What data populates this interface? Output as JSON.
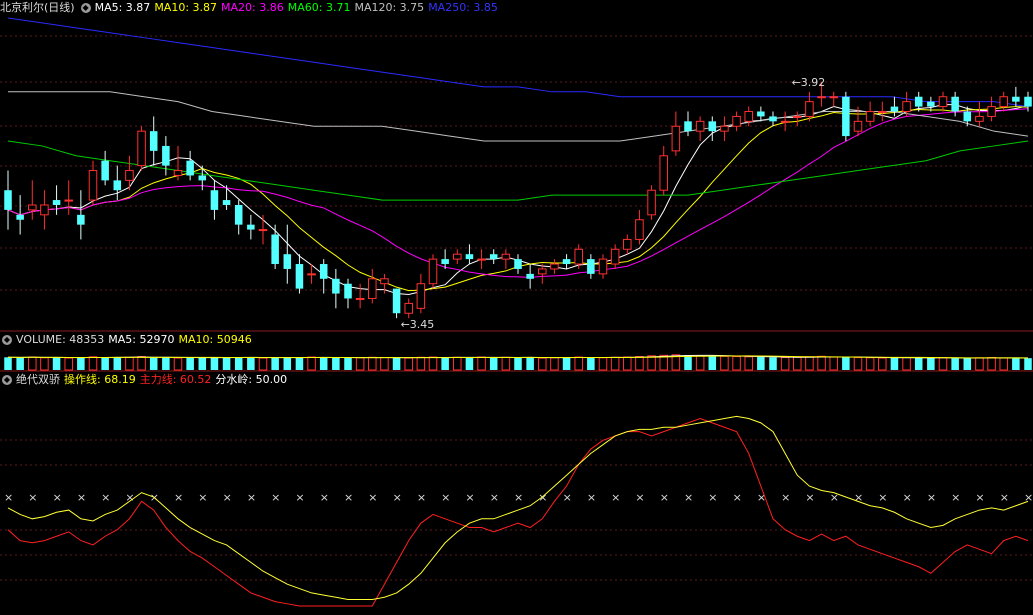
{
  "main": {
    "title": "北京利尔(日线)",
    "indicators": [
      {
        "label": "MA5: 3.87",
        "color": "#ffffff"
      },
      {
        "label": "MA10: 3.87",
        "color": "#ffff00"
      },
      {
        "label": "MA20: 3.86",
        "color": "#ff00ff"
      },
      {
        "label": "MA60: 3.71",
        "color": "#00ff00"
      },
      {
        "label": "MA120: 3.75",
        "color": "#c0c0c0"
      },
      {
        "label": "MA250: 3.85",
        "color": "#3333ff"
      }
    ],
    "high_marker": "3.92",
    "low_marker": "3.45"
  },
  "volume": {
    "title": "VOLUME: 48353",
    "indicators": [
      {
        "label": "MA5: 52970",
        "color": "#ffffff"
      },
      {
        "label": "MA10: 50946",
        "color": "#ffff00"
      }
    ]
  },
  "oscillator": {
    "title": "绝代双骄",
    "indicators": [
      {
        "label": "操作线: 68.19",
        "color": "#ffff00"
      },
      {
        "label": "主力线: 60.52",
        "color": "#ff2020"
      },
      {
        "label": "分水岭: 50.00",
        "color": "#ffffff"
      }
    ]
  },
  "chart_data": {
    "type": "candlestick",
    "price_range": [
      3.42,
      4.05
    ],
    "candles": [
      [
        3.7,
        3.66,
        3.74,
        3.62
      ],
      [
        3.65,
        3.64,
        3.69,
        3.61
      ],
      [
        3.66,
        3.67,
        3.72,
        3.64
      ],
      [
        3.65,
        3.67,
        3.7,
        3.62
      ],
      [
        3.68,
        3.67,
        3.71,
        3.65
      ],
      [
        3.68,
        3.68,
        3.72,
        3.65
      ],
      [
        3.65,
        3.63,
        3.7,
        3.6
      ],
      [
        3.68,
        3.74,
        3.76,
        3.67
      ],
      [
        3.76,
        3.72,
        3.78,
        3.71
      ],
      [
        3.72,
        3.7,
        3.75,
        3.68
      ],
      [
        3.72,
        3.74,
        3.77,
        3.7
      ],
      [
        3.75,
        3.82,
        3.83,
        3.74
      ],
      [
        3.82,
        3.78,
        3.85,
        3.75
      ],
      [
        3.79,
        3.75,
        3.81,
        3.73
      ],
      [
        3.73,
        3.74,
        3.79,
        3.72
      ],
      [
        3.76,
        3.73,
        3.78,
        3.72
      ],
      [
        3.73,
        3.72,
        3.75,
        3.7
      ],
      [
        3.7,
        3.66,
        3.72,
        3.64
      ],
      [
        3.68,
        3.67,
        3.71,
        3.66
      ],
      [
        3.67,
        3.63,
        3.68,
        3.61
      ],
      [
        3.63,
        3.62,
        3.65,
        3.6
      ],
      [
        3.62,
        3.62,
        3.65,
        3.59
      ],
      [
        3.61,
        3.55,
        3.63,
        3.54
      ],
      [
        3.57,
        3.54,
        3.63,
        3.51
      ],
      [
        3.55,
        3.5,
        3.57,
        3.49
      ],
      [
        3.53,
        3.53,
        3.55,
        3.51
      ],
      [
        3.55,
        3.52,
        3.56,
        3.49
      ],
      [
        3.52,
        3.49,
        3.54,
        3.46
      ],
      [
        3.51,
        3.48,
        3.52,
        3.46
      ],
      [
        3.48,
        3.48,
        3.51,
        3.46
      ],
      [
        3.48,
        3.52,
        3.54,
        3.47
      ],
      [
        3.51,
        3.52,
        3.53,
        3.49
      ],
      [
        3.5,
        3.45,
        3.5,
        3.44
      ],
      [
        3.45,
        3.47,
        3.48,
        3.44
      ],
      [
        3.46,
        3.51,
        3.53,
        3.45
      ],
      [
        3.51,
        3.56,
        3.57,
        3.5
      ],
      [
        3.56,
        3.55,
        3.58,
        3.54
      ],
      [
        3.56,
        3.57,
        3.58,
        3.55
      ],
      [
        3.57,
        3.56,
        3.59,
        3.55
      ],
      [
        3.56,
        3.56,
        3.58,
        3.54
      ],
      [
        3.57,
        3.56,
        3.58,
        3.55
      ],
      [
        3.56,
        3.57,
        3.58,
        3.54
      ],
      [
        3.56,
        3.54,
        3.57,
        3.53
      ],
      [
        3.53,
        3.52,
        3.55,
        3.5
      ],
      [
        3.53,
        3.54,
        3.55,
        3.51
      ],
      [
        3.54,
        3.55,
        3.56,
        3.53
      ],
      [
        3.56,
        3.55,
        3.57,
        3.54
      ],
      [
        3.55,
        3.58,
        3.59,
        3.54
      ],
      [
        3.56,
        3.53,
        3.57,
        3.52
      ],
      [
        3.53,
        3.56,
        3.57,
        3.52
      ],
      [
        3.55,
        3.58,
        3.59,
        3.54
      ],
      [
        3.58,
        3.6,
        3.61,
        3.57
      ],
      [
        3.6,
        3.64,
        3.66,
        3.59
      ],
      [
        3.65,
        3.7,
        3.71,
        3.64
      ],
      [
        3.7,
        3.77,
        3.79,
        3.69
      ],
      [
        3.78,
        3.83,
        3.86,
        3.77
      ],
      [
        3.84,
        3.82,
        3.86,
        3.81
      ],
      [
        3.82,
        3.84,
        3.85,
        3.8
      ],
      [
        3.84,
        3.82,
        3.85,
        3.8
      ],
      [
        3.82,
        3.83,
        3.85,
        3.8
      ],
      [
        3.83,
        3.85,
        3.86,
        3.82
      ],
      [
        3.84,
        3.86,
        3.87,
        3.83
      ],
      [
        3.86,
        3.85,
        3.87,
        3.84
      ],
      [
        3.85,
        3.84,
        3.86,
        3.83
      ],
      [
        3.84,
        3.84,
        3.86,
        3.82
      ],
      [
        3.85,
        3.85,
        3.86,
        3.83
      ],
      [
        3.85,
        3.88,
        3.9,
        3.84
      ],
      [
        3.89,
        3.89,
        3.92,
        3.87
      ],
      [
        3.89,
        3.89,
        3.9,
        3.87
      ],
      [
        3.89,
        3.81,
        3.9,
        3.8
      ],
      [
        3.82,
        3.84,
        3.87,
        3.81
      ],
      [
        3.84,
        3.86,
        3.88,
        3.83
      ],
      [
        3.86,
        3.86,
        3.88,
        3.84
      ],
      [
        3.87,
        3.86,
        3.89,
        3.85
      ],
      [
        3.86,
        3.88,
        3.9,
        3.85
      ],
      [
        3.89,
        3.87,
        3.9,
        3.86
      ],
      [
        3.88,
        3.87,
        3.89,
        3.86
      ],
      [
        3.87,
        3.89,
        3.9,
        3.86
      ],
      [
        3.89,
        3.86,
        3.9,
        3.85
      ],
      [
        3.86,
        3.84,
        3.87,
        3.83
      ],
      [
        3.84,
        3.85,
        3.88,
        3.83
      ],
      [
        3.85,
        3.87,
        3.89,
        3.84
      ],
      [
        3.87,
        3.89,
        3.9,
        3.86
      ],
      [
        3.89,
        3.88,
        3.91,
        3.87
      ],
      [
        3.89,
        3.87,
        3.9,
        3.86
      ]
    ],
    "ma_lines": [
      {
        "name": "MA5",
        "color": "#ffffff",
        "period": 5
      },
      {
        "name": "MA10",
        "color": "#ffff00",
        "period": 10
      },
      {
        "name": "MA20",
        "color": "#ff00ff",
        "period": 20
      },
      {
        "name": "MA60",
        "color": "#00cc00",
        "values": [
          3.8,
          3.79,
          3.77,
          3.76,
          3.75,
          3.74,
          3.73,
          3.72,
          3.71,
          3.7,
          3.69,
          3.68,
          3.68,
          3.68,
          3.68,
          3.68,
          3.69,
          3.69,
          3.69,
          3.69,
          3.69,
          3.7,
          3.71,
          3.72,
          3.73,
          3.74,
          3.75,
          3.76,
          3.78,
          3.79,
          3.8
        ]
      },
      {
        "name": "MA120",
        "color": "#c0c0c0",
        "values": [
          3.9,
          3.9,
          3.9,
          3.9,
          3.89,
          3.88,
          3.86,
          3.85,
          3.84,
          3.83,
          3.83,
          3.83,
          3.82,
          3.81,
          3.8,
          3.8,
          3.8,
          3.8,
          3.8,
          3.81,
          3.82,
          3.83,
          3.84,
          3.85,
          3.86,
          3.86,
          3.86,
          3.85,
          3.84,
          3.82,
          3.81
        ]
      },
      {
        "name": "MA250",
        "color": "#2a2aff",
        "values": [
          4.05,
          4.04,
          4.03,
          4.02,
          4.01,
          4.0,
          3.99,
          3.98,
          3.97,
          3.96,
          3.95,
          3.94,
          3.93,
          3.92,
          3.91,
          3.91,
          3.9,
          3.9,
          3.89,
          3.89,
          3.89,
          3.89,
          3.89,
          3.89,
          3.89,
          3.89,
          3.89,
          3.88,
          3.88,
          3.88,
          3.87
        ]
      }
    ],
    "volume_range": [
      0,
      90000
    ],
    "volumes": [
      52000,
      51000,
      53000,
      50000,
      52000,
      49000,
      50000,
      54000,
      51000,
      53000,
      52000,
      55000,
      50000,
      51000,
      49000,
      50000,
      52000,
      51000,
      50000,
      53000,
      52000,
      49000,
      51000,
      50000,
      52000,
      53000,
      51000,
      50000,
      49000,
      50000,
      52000,
      51000,
      50000,
      49000,
      52000,
      53000,
      51000,
      52000,
      50000,
      53000,
      51000,
      52000,
      50000,
      51000,
      49000,
      50000,
      52000,
      53000,
      51000,
      50000,
      52000,
      53000,
      55000,
      58000,
      60000,
      62000,
      61000,
      58000,
      57000,
      56000,
      55000,
      54000,
      53000,
      52000,
      51000,
      52000,
      54000,
      56000,
      53000,
      52000,
      51000,
      50000,
      49000,
      50000,
      51000,
      50000,
      49000,
      50000,
      48000,
      49000,
      50000,
      51000,
      49000,
      48500,
      48353
    ],
    "oscillator_range": [
      0,
      100
    ],
    "operation_line": [
      45,
      42,
      40,
      41,
      43,
      44,
      40,
      39,
      42,
      44,
      48,
      52,
      50,
      45,
      40,
      36,
      33,
      30,
      28,
      24,
      20,
      16,
      13,
      10,
      8,
      6,
      5,
      4,
      3,
      3,
      3,
      4,
      6,
      10,
      15,
      22,
      29,
      34,
      38,
      40,
      40,
      42,
      44,
      46,
      50,
      55,
      60,
      65,
      70,
      74,
      78,
      80,
      81,
      81,
      82,
      82,
      83,
      84,
      85,
      86,
      87,
      86,
      84,
      80,
      70,
      60,
      55,
      53,
      52,
      50,
      48,
      46,
      45,
      43,
      40,
      38,
      36,
      37,
      40,
      42,
      44,
      45,
      44,
      46,
      48
    ],
    "main_line": [
      35,
      30,
      29,
      30,
      32,
      34,
      30,
      28,
      32,
      35,
      40,
      48,
      44,
      36,
      30,
      25,
      22,
      18,
      14,
      10,
      6,
      4,
      2,
      1,
      0,
      0,
      0,
      -1,
      -1,
      -1,
      0,
      10,
      20,
      30,
      38,
      42,
      40,
      38,
      36,
      36,
      34,
      36,
      38,
      36,
      40,
      48,
      55,
      65,
      72,
      76,
      78,
      80,
      80,
      78,
      80,
      82,
      84,
      86,
      84,
      82,
      80,
      70,
      55,
      40,
      35,
      32,
      30,
      33,
      30,
      32,
      28,
      26,
      24,
      22,
      20,
      18,
      15,
      20,
      25,
      28,
      26,
      24,
      30,
      32,
      30
    ],
    "watershed": 50.0
  }
}
